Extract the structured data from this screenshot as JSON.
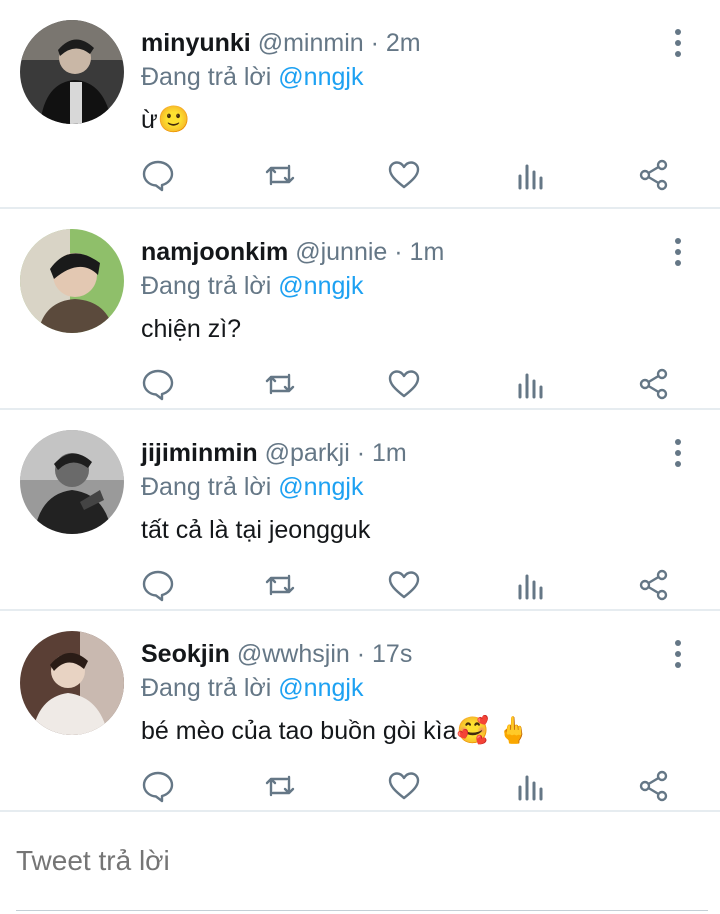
{
  "reply_prefix": "Đang trả lời",
  "tweets": [
    {
      "name": "minyunki",
      "handle": "@minmin",
      "time": "· 2m",
      "mention": "@nngjk",
      "text": "ừ",
      "emoji": "🙂"
    },
    {
      "name": "namjoonkim",
      "handle": "@junnie",
      "time": "· 1m",
      "mention": "@nngjk",
      "text": "chiện zì?",
      "emoji": ""
    },
    {
      "name": "jijiminmin",
      "handle": "@parkji",
      "time": "· 1m",
      "mention": "@nngjk",
      "text": "tất cả là tại jeongguk",
      "emoji": ""
    },
    {
      "name": "Seokjin",
      "handle": "@wwhsjin",
      "time": "· 17s",
      "mention": "@nngjk",
      "text": "bé mèo của tao buồn gòi kìa",
      "emoji": "🥰 🖕"
    }
  ],
  "compose": {
    "placeholder": "Tweet trả lời"
  },
  "icons": [
    "reply-icon",
    "retweet-icon",
    "like-icon",
    "analytics-icon",
    "share-icon",
    "more-options-icon"
  ],
  "colors": {
    "mention": "#1da1f2",
    "secondary": "#657786",
    "icon": "#657786",
    "divider": "#e6ecf0"
  }
}
